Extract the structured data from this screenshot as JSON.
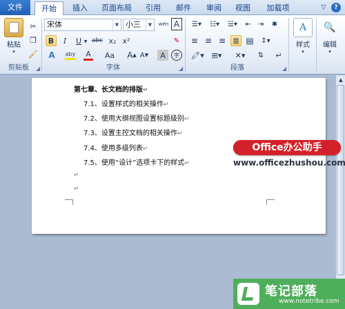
{
  "tabs": [
    "文件",
    "开始",
    "插入",
    "页面布局",
    "引用",
    "邮件",
    "审阅",
    "视图",
    "加载项"
  ],
  "ribbon": {
    "clipboard": {
      "paste_label": "粘贴",
      "group_label": "剪贴板"
    },
    "font": {
      "name": "宋体",
      "size": "小三",
      "group_label": "字体",
      "bold": "B",
      "italic": "I",
      "underline": "U",
      "strike": "abc",
      "sub": "x₂",
      "sup": "x²",
      "grow": "A",
      "shrink": "A",
      "case": "Aa",
      "clear": "A",
      "wen": "wén",
      "border_a": "A",
      "color_a": "A",
      "highlight": "aby",
      "circle": "字"
    },
    "paragraph": {
      "group_label": "段落"
    },
    "styles": {
      "label": "样式"
    },
    "editing": {
      "label": "编辑"
    }
  },
  "document": {
    "lines": [
      "第七章、长文档的排版",
      "7.1、设置样式的相关操作",
      "7.2、使用大纲视图设置标题级别",
      "7.3、设置主控文档的相关操作",
      "7.4、使用多级列表",
      "7.5、使用“设计”选项卡下的样式"
    ],
    "para_mark": "↵"
  },
  "watermarks": {
    "badge": "Office办公助手",
    "url": "www.officezhushou.com",
    "site_name": "笔记部落",
    "site_url": "www.notetribe.com"
  },
  "colors": {
    "file_tab": "#2a6cc4",
    "badge": "#d4202a",
    "site": "#4fae5b",
    "highlight": "#f8d270"
  }
}
